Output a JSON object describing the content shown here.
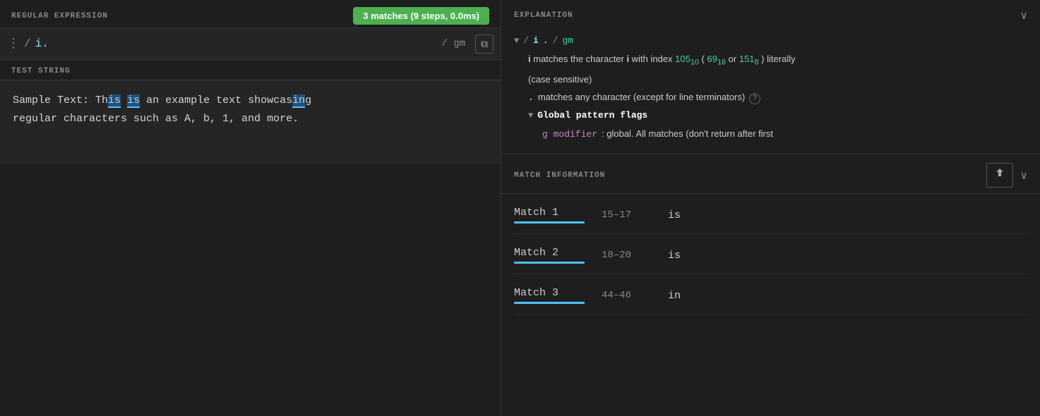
{
  "left": {
    "regex_section_label": "REGULAR EXPRESSION",
    "matches_badge": "3 matches (9 steps, 0.0ms)",
    "regex_value": "i.",
    "regex_prefix": "/ ",
    "regex_suffix": "/ gm",
    "copy_icon": "⧉",
    "dots_icon": "⋮",
    "test_string_label": "TEST STRING",
    "test_string_line1_before": "Sample Text: Th",
    "test_string_line1_hl1": "is",
    "test_string_line1_mid": " ",
    "test_string_line1_hl2": "is",
    "test_string_line1_after": " an example text showcas",
    "test_string_line1_hl3": "in",
    "test_string_line1_end": "g",
    "test_string_line2": "regular characters such as A, b, 1, and more."
  },
  "right": {
    "explanation_label": "EXPLANATION",
    "chevron": "∨",
    "exp_pattern_i": "i",
    "exp_dot": ".",
    "exp_flags": "gm",
    "exp_slash": "/",
    "exp_i_text": "i matches the character i with index ",
    "exp_105_10": "105",
    "exp_105_base": "10",
    "exp_69_16": "69",
    "exp_69_base": "16",
    "exp_151_8": "151",
    "exp_151_base": "8",
    "exp_literally": " literally",
    "exp_case_sensitive": "(case sensitive)",
    "exp_dot_text": ". matches any character (except for line terminators)",
    "exp_global_flags": "Global pattern flags",
    "exp_g_modifier": "g modifier",
    "exp_g_text": ": global. All matches (don't return after first",
    "match_info_label": "MATCH INFORMATION",
    "share_icon": "↑",
    "matches": [
      {
        "label": "Match 1",
        "range": "15–17",
        "value": "is"
      },
      {
        "label": "Match 2",
        "range": "18–20",
        "value": "is"
      },
      {
        "label": "Match 3",
        "range": "44–46",
        "value": "in"
      }
    ]
  }
}
